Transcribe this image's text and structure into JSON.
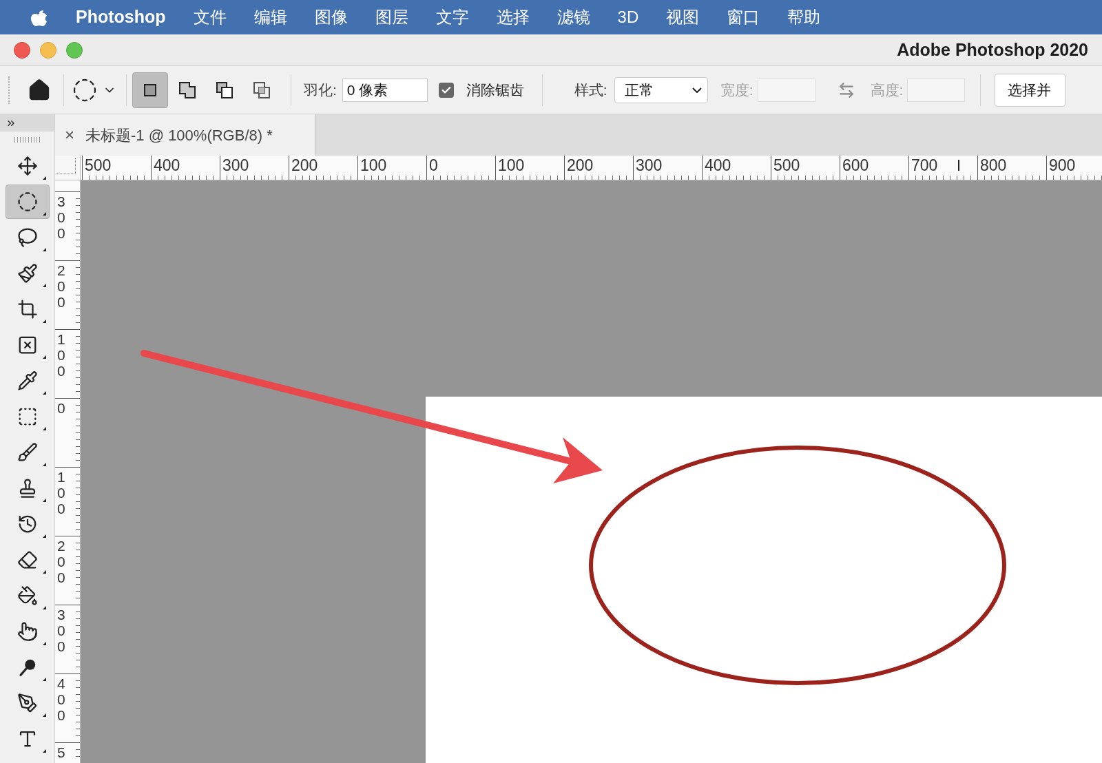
{
  "menu_bar": {
    "app_name": "Photoshop",
    "items": [
      "文件",
      "编辑",
      "图像",
      "图层",
      "文字",
      "选择",
      "滤镜",
      "3D",
      "视图",
      "窗口",
      "帮助"
    ]
  },
  "window": {
    "title": "Adobe Photoshop 2020"
  },
  "options_bar": {
    "selection_modes": [
      {
        "selected": true
      },
      {
        "selected": false
      },
      {
        "selected": false
      },
      {
        "selected": false
      }
    ],
    "feather": {
      "label": "羽化:",
      "value": "0 像素"
    },
    "anti_alias": {
      "label": "消除锯齿",
      "checked": true
    },
    "style": {
      "label": "样式:",
      "value": "正常"
    },
    "width": {
      "label": "宽度:",
      "disabled": true
    },
    "height": {
      "label": "高度:",
      "disabled": true
    },
    "select_mask_button": "选择并"
  },
  "document_tab": {
    "close": "×",
    "title": "未标题-1 @ 100%(RGB/8) *"
  },
  "rulers": {
    "horizontal": [
      "500",
      "400",
      "300",
      "200",
      "100",
      "0",
      "100",
      "200",
      "300",
      "400",
      "500",
      "600",
      "700",
      "800",
      "900"
    ],
    "vertical": [
      "300",
      "200",
      "100",
      "0",
      "100",
      "200",
      "300",
      "400",
      "5"
    ]
  },
  "tools": [
    {
      "selected": false
    },
    {
      "selected": true
    },
    {
      "selected": false
    },
    {
      "selected": false
    },
    {
      "selected": false
    },
    {
      "selected": false
    },
    {
      "selected": false
    },
    {
      "selected": false
    },
    {
      "selected": false
    },
    {
      "selected": false
    },
    {
      "selected": false
    },
    {
      "selected": false
    },
    {
      "selected": false
    },
    {
      "selected": false
    },
    {
      "selected": false
    },
    {
      "selected": false
    },
    {
      "selected": false
    }
  ]
}
